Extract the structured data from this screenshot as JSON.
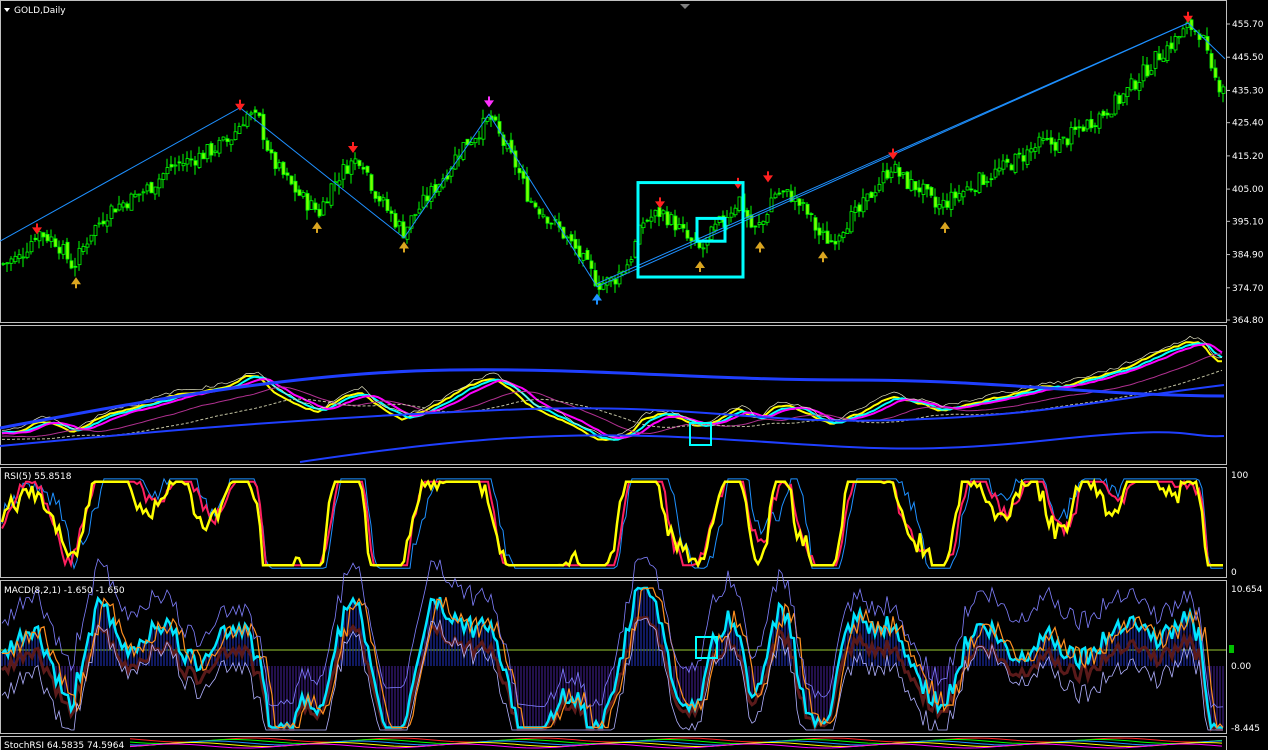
{
  "chart_data": [
    {
      "type": "candlestick",
      "title": "GOLD,Daily",
      "yticks": [
        "455.70",
        "445.50",
        "435.30",
        "425.40",
        "415.20",
        "405.00",
        "395.10",
        "384.90",
        "374.70",
        "364.80"
      ],
      "ylim": [
        364.8,
        460
      ],
      "colors": {
        "bull": "#00ff00",
        "bear": "#00ff00",
        "body": "#7cfc00",
        "zigzag": "#1e90ff",
        "box": "#00ffff"
      },
      "path": [
        [
          0,
          382
        ],
        [
          18,
          384
        ],
        [
          36,
          392
        ],
        [
          55,
          389
        ],
        [
          72,
          381
        ],
        [
          90,
          392
        ],
        [
          110,
          399
        ],
        [
          130,
          402
        ],
        [
          150,
          406
        ],
        [
          170,
          412
        ],
        [
          190,
          414
        ],
        [
          210,
          417
        ],
        [
          228,
          420
        ],
        [
          245,
          428
        ],
        [
          258,
          426
        ],
        [
          270,
          414
        ],
        [
          290,
          406
        ],
        [
          305,
          401
        ],
        [
          318,
          398
        ],
        [
          330,
          406
        ],
        [
          345,
          412
        ],
        [
          360,
          415
        ],
        [
          372,
          405
        ],
        [
          385,
          399
        ],
        [
          402,
          392
        ],
        [
          415,
          398
        ],
        [
          430,
          404
        ],
        [
          445,
          410
        ],
        [
          460,
          418
        ],
        [
          475,
          422
        ],
        [
          489,
          427
        ],
        [
          500,
          420
        ],
        [
          515,
          412
        ],
        [
          528,
          402
        ],
        [
          545,
          397
        ],
        [
          560,
          392
        ],
        [
          575,
          386
        ],
        [
          597,
          376
        ],
        [
          612,
          377
        ],
        [
          628,
          383
        ],
        [
          642,
          395
        ],
        [
          660,
          398
        ],
        [
          675,
          394
        ],
        [
          690,
          388
        ],
        [
          700,
          386
        ],
        [
          712,
          392
        ],
        [
          725,
          397
        ],
        [
          738,
          402
        ],
        [
          752,
          392
        ],
        [
          762,
          395
        ],
        [
          772,
          404
        ],
        [
          790,
          403
        ],
        [
          805,
          398
        ],
        [
          818,
          391
        ],
        [
          830,
          389
        ],
        [
          845,
          395
        ],
        [
          858,
          398
        ],
        [
          875,
          406
        ],
        [
          890,
          412
        ],
        [
          905,
          407
        ],
        [
          920,
          405
        ],
        [
          935,
          399
        ],
        [
          950,
          402
        ],
        [
          965,
          405
        ],
        [
          980,
          408
        ],
        [
          1000,
          411
        ],
        [
          1020,
          415
        ],
        [
          1040,
          419
        ],
        [
          1060,
          419
        ],
        [
          1080,
          424
        ],
        [
          1100,
          428
        ],
        [
          1120,
          433
        ],
        [
          1140,
          440
        ],
        [
          1160,
          447
        ],
        [
          1175,
          451
        ],
        [
          1188,
          455
        ],
        [
          1200,
          453
        ],
        [
          1210,
          440
        ],
        [
          1218,
          437
        ],
        [
          1225,
          438
        ]
      ],
      "down_arrows": [
        {
          "x": 37,
          "y": 392,
          "color": "#ff2020"
        },
        {
          "x": 240,
          "y": 430,
          "color": "#ff2020"
        },
        {
          "x": 353,
          "y": 417,
          "color": "#ff2020"
        },
        {
          "x": 489,
          "y": 431,
          "color": "#ff30ff"
        },
        {
          "x": 660,
          "y": 400,
          "color": "#ff2020"
        },
        {
          "x": 738,
          "y": 406,
          "color": "#ff2020"
        },
        {
          "x": 768,
          "y": 408,
          "color": "#ff2020"
        },
        {
          "x": 893,
          "y": 415,
          "color": "#ff2020"
        },
        {
          "x": 1188,
          "y": 457,
          "color": "#ff2020"
        }
      ],
      "up_arrows": [
        {
          "x": 76,
          "y": 377,
          "color": "#daa520"
        },
        {
          "x": 317,
          "y": 394,
          "color": "#daa520"
        },
        {
          "x": 404,
          "y": 388,
          "color": "#daa520"
        },
        {
          "x": 597,
          "y": 372,
          "color": "#1e90ff"
        },
        {
          "x": 700,
          "y": 382,
          "color": "#daa520"
        },
        {
          "x": 760,
          "y": 388,
          "color": "#daa520"
        },
        {
          "x": 823,
          "y": 385,
          "color": "#daa520"
        },
        {
          "x": 945,
          "y": 394,
          "color": "#daa520"
        }
      ],
      "zigzag": [
        [
          0,
          389
        ],
        [
          240,
          430
        ],
        [
          404,
          390
        ],
        [
          489,
          428
        ],
        [
          597,
          375
        ],
        [
          1188,
          456
        ],
        [
          1225,
          445
        ]
      ],
      "trendline": [
        [
          597,
          376
        ],
        [
          1188,
          456
        ]
      ],
      "boxes": [
        {
          "x0": 638,
          "x1": 743,
          "y0": 378,
          "y1": 407
        },
        {
          "x0": 697,
          "x1": 725,
          "y0": 389,
          "y1": 396
        }
      ]
    },
    {
      "type": "line",
      "title": "",
      "note": "moving averages / envelope panel",
      "boxes": [
        {
          "cx": 700
        }
      ]
    },
    {
      "type": "line",
      "title": "RSI(5) 55.8518",
      "yticks": [
        "100",
        "0"
      ],
      "ylim": [
        0,
        100
      ]
    },
    {
      "type": "histogram",
      "title": "MACD(8,2,1) -1.650 -1.650",
      "yticks": [
        "10.654",
        "0.00",
        "-8.445"
      ],
      "ylim": [
        -8.445,
        10.654
      ],
      "boxes": [
        {
          "cx": 706
        }
      ]
    },
    {
      "type": "line",
      "title": "StochRSI 64.5835 74.5964"
    }
  ]
}
